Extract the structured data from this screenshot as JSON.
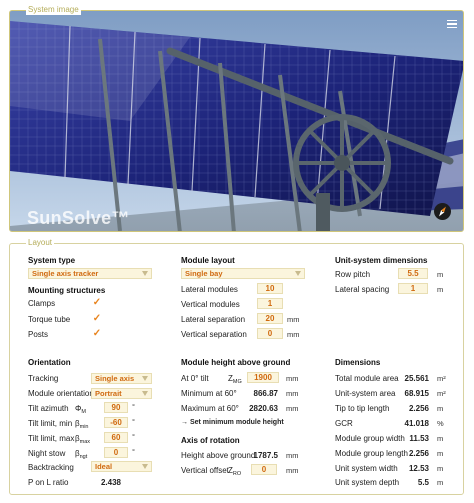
{
  "image_panel": {
    "caption": "System image",
    "watermark": "SunSolve™",
    "menu_icon": "hamburger-menu-icon",
    "compass_icon": "compass-icon",
    "sky_color": "#c6d7ea",
    "panel_color": "#1c2378",
    "frame_color": "#5e6a70"
  },
  "layout": {
    "caption": "Layout",
    "system_type": {
      "heading": "System type",
      "value": "Single axis tracker"
    },
    "mounting": {
      "heading": "Mounting structures",
      "clamps": "Clamps",
      "torque_tube": "Torque tube",
      "posts": "Posts",
      "check_glyph": "✓"
    },
    "orientation": {
      "heading": "Orientation",
      "tracking_label": "Tracking",
      "tracking_value": "Single axis",
      "module_orientation_label": "Module orientation",
      "module_orientation_value": "Portrait",
      "tilt_azimuth_label": "Tilt azimuth",
      "tilt_azimuth_sym": "ΦM",
      "tilt_azimuth_value": "90",
      "tilt_azimuth_unit": "°",
      "tilt_min_label": "Tilt limit, min",
      "tilt_min_sym": "βmin",
      "tilt_min_value": "-60",
      "tilt_min_unit": "°",
      "tilt_max_label": "Tilt limit, max",
      "tilt_max_sym": "βmax",
      "tilt_max_value": "60",
      "tilt_max_unit": "°",
      "night_stow_label": "Night stow",
      "night_stow_sym": "βngt",
      "night_stow_value": "0",
      "night_stow_unit": "°",
      "backtracking_label": "Backtracking",
      "backtracking_value": "Ideal",
      "p_on_l_label": "P on L ratio",
      "p_on_l_value": "2.438"
    },
    "module_layout": {
      "heading": "Module layout",
      "type_value": "Single bay",
      "lateral_modules_label": "Lateral modules",
      "lateral_modules_value": "10",
      "vertical_modules_label": "Vertical modules",
      "vertical_modules_value": "1",
      "lateral_separation_label": "Lateral separation",
      "lateral_separation_value": "20",
      "lateral_separation_unit": "mm",
      "vertical_separation_label": "Vertical separation",
      "vertical_separation_value": "0",
      "vertical_separation_unit": "mm"
    },
    "module_height": {
      "heading": "Module height above ground",
      "at0_label": "At 0° tilt",
      "at0_sym": "ZMG",
      "at0_value": "1900",
      "at0_unit": "mm",
      "min60_label": "Minimum at 60°",
      "min60_value": "866.87",
      "min60_unit": "mm",
      "max60_label": "Maximum at 60°",
      "max60_value": "2820.63",
      "max60_unit": "mm",
      "set_min_link": "→ Set minimum module height"
    },
    "axis_rotation": {
      "heading": "Axis of rotation",
      "height_label": "Height above ground",
      "height_value": "1787.5",
      "height_unit": "mm",
      "offset_label": "Vertical offset",
      "offset_sym": "ZRO",
      "offset_value": "0",
      "offset_unit": "mm"
    },
    "unit_system": {
      "heading": "Unit-system dimensions",
      "row_pitch_label": "Row pitch",
      "row_pitch_value": "5.5",
      "row_pitch_unit": "m",
      "lateral_spacing_label": "Lateral spacing",
      "lateral_spacing_value": "1",
      "lateral_spacing_unit": "m"
    },
    "dimensions": {
      "heading": "Dimensions",
      "rows": [
        {
          "label": "Total module area",
          "value": "25.561",
          "unit": "m²"
        },
        {
          "label": "Unit-system area",
          "value": "68.915",
          "unit": "m²"
        },
        {
          "label": "Tip to tip length",
          "value": "2.256",
          "unit": "m"
        },
        {
          "label": "GCR",
          "value": "41.018",
          "unit": "%"
        },
        {
          "label": "Module group width",
          "value": "11.53",
          "unit": "m"
        },
        {
          "label": "Module group length",
          "value": "2.256",
          "unit": "m"
        },
        {
          "label": "Unit system width",
          "value": "12.53",
          "unit": "m"
        },
        {
          "label": "Unit system depth",
          "value": "5.5",
          "unit": "m"
        }
      ]
    }
  }
}
